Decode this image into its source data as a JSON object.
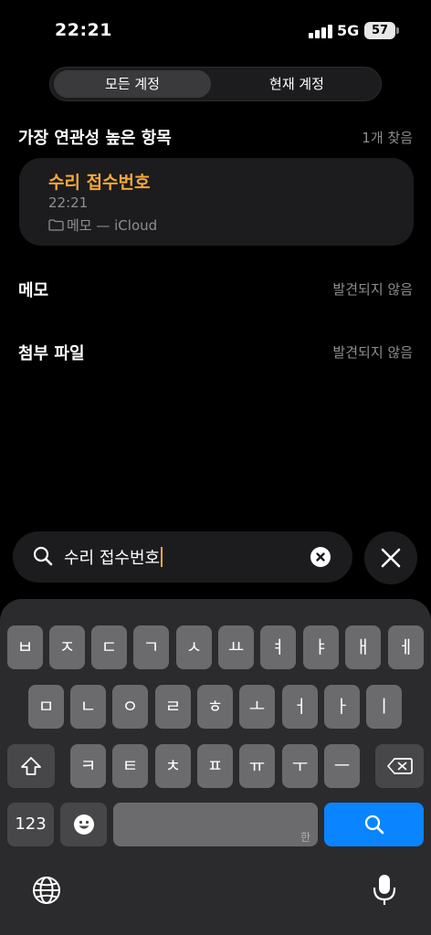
{
  "status": {
    "time": "22:21",
    "network": "5G",
    "battery": "57"
  },
  "segments": [
    "모든 계정",
    "현재 계정"
  ],
  "top_hits": {
    "title": "가장 연관성 높은 항목",
    "count": "1개 찾음"
  },
  "result": {
    "title": "수리 접수번호",
    "time": "22:21",
    "folder": "메모 — iCloud"
  },
  "notes": {
    "title": "메모",
    "status": "발견되지 않음"
  },
  "attachments": {
    "title": "첨부 파일",
    "status": "발견되지 않음"
  },
  "search": {
    "text": "수리 접수번호"
  },
  "keyboard": {
    "row1": [
      "ㅂ",
      "ㅈ",
      "ㄷ",
      "ㄱ",
      "ㅅ",
      "ㅛ",
      "ㅕ",
      "ㅑ",
      "ㅐ",
      "ㅔ"
    ],
    "row2": [
      "ㅁ",
      "ㄴ",
      "ㅇ",
      "ㄹ",
      "ㅎ",
      "ㅗ",
      "ㅓ",
      "ㅏ",
      "ㅣ"
    ],
    "row3": [
      "ㅋ",
      "ㅌ",
      "ㅊ",
      "ㅍ",
      "ㅠ",
      "ㅜ",
      "ㅡ"
    ],
    "numbers": "123",
    "space_hint": "한"
  },
  "colors": {
    "accent": "#f2a93b",
    "search_blue": "#0a84ff"
  }
}
